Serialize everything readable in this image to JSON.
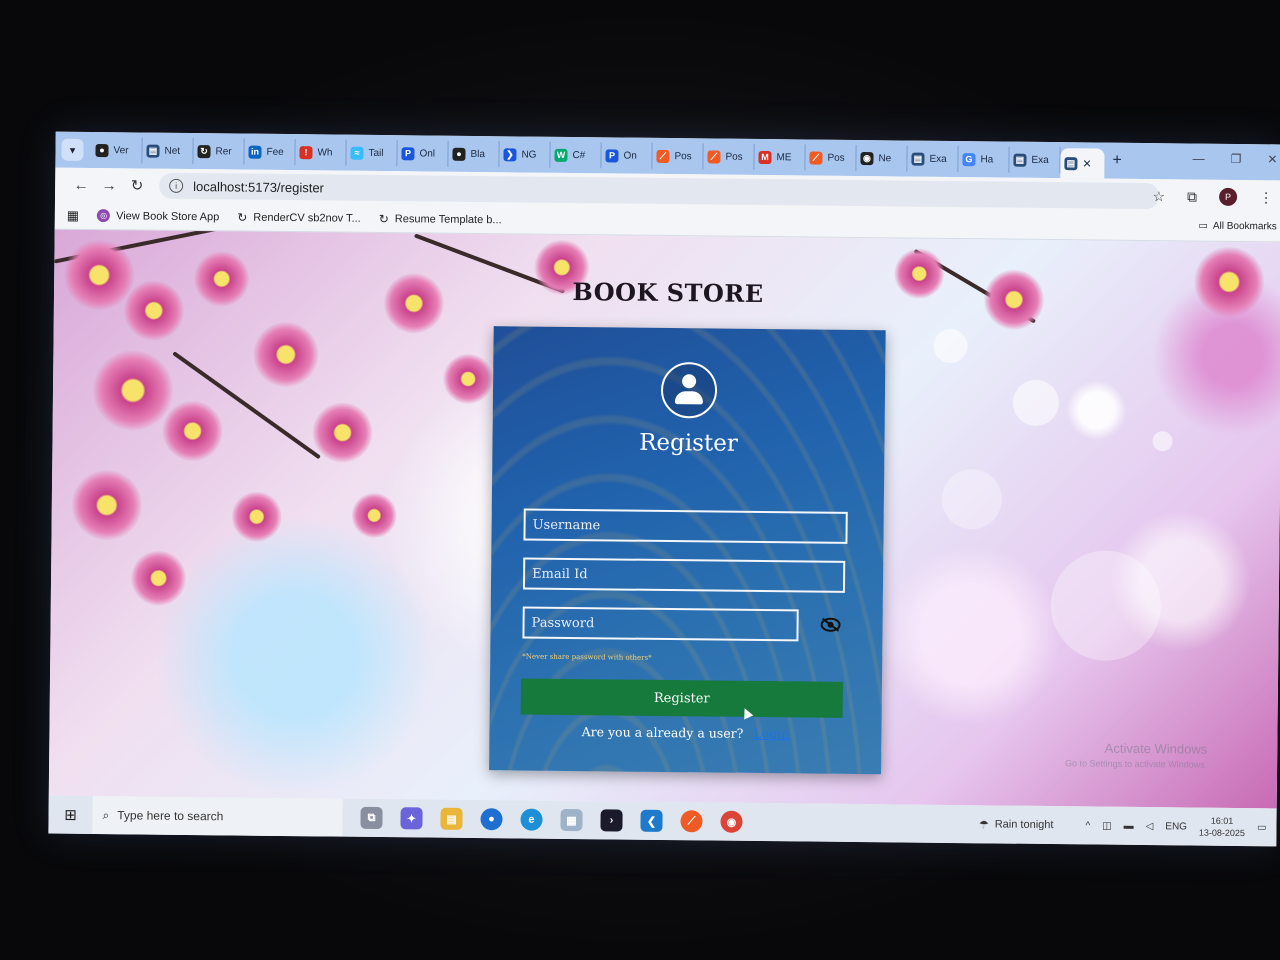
{
  "browser": {
    "tabs": [
      {
        "label": "Ver",
        "icon": "github-icon",
        "color": "#222222"
      },
      {
        "label": "Net",
        "icon": "store-icon",
        "color": "#2a4d7a"
      },
      {
        "label": "Rer",
        "icon": "render-icon",
        "color": "#222222"
      },
      {
        "label": "Fee",
        "icon": "linkedin-icon",
        "color": "#0a66c2"
      },
      {
        "label": "Wh",
        "icon": "alert-icon",
        "color": "#d93025"
      },
      {
        "label": "Tail",
        "icon": "tailwind-icon",
        "color": "#38bdf8"
      },
      {
        "label": "Onl",
        "icon": "p-icon",
        "color": "#1a56db"
      },
      {
        "label": "Bla",
        "icon": "github-icon",
        "color": "#222222"
      },
      {
        "label": "NG",
        "icon": "chevron-icon",
        "color": "#1a56db"
      },
      {
        "label": "C#",
        "icon": "w3-icon",
        "color": "#04aa6d"
      },
      {
        "label": "On",
        "icon": "p-icon",
        "color": "#1a56db"
      },
      {
        "label": "Pos",
        "icon": "postman-icon",
        "color": "#ef5b25"
      },
      {
        "label": "Pos",
        "icon": "postman-icon",
        "color": "#ef5b25"
      },
      {
        "label": "ME",
        "icon": "gmail-icon",
        "color": "#d93025"
      },
      {
        "label": "Pos",
        "icon": "postman-icon",
        "color": "#ef5b25"
      },
      {
        "label": "Ne",
        "icon": "chrome-icon",
        "color": "#222222"
      },
      {
        "label": "Exa",
        "icon": "store-icon",
        "color": "#2a4d7a"
      },
      {
        "label": "Ha",
        "icon": "google-icon",
        "color": "#4285f4"
      },
      {
        "label": "Exa",
        "icon": "store-icon",
        "color": "#2a4d7a"
      }
    ],
    "active_tab_icon": "store-icon",
    "url": "localhost:5173/register",
    "bookmarks": [
      {
        "label": "View Book Store App",
        "icon": "app-icon"
      },
      {
        "label": "RenderCV sb2nov T...",
        "icon": "render-icon"
      },
      {
        "label": "Resume Template b...",
        "icon": "render-icon"
      }
    ],
    "all_bookmarks": "All Bookmarks",
    "profile_initial": "P"
  },
  "page": {
    "store_title": "BOOK STORE",
    "form_title": "Register",
    "username_placeholder": "Username",
    "email_placeholder": "Email Id",
    "password_placeholder": "Password",
    "password_hint": "*Never share password with others*",
    "submit_label": "Register",
    "login_prompt": "Are you a already a user?",
    "login_link": "Login",
    "accent_color": "#157a3c"
  },
  "watermark": {
    "title": "Activate Windows",
    "subtitle": "Go to Settings to activate Windows."
  },
  "taskbar": {
    "search_placeholder": "Type here to search",
    "weather": "Rain tonight",
    "language": "ENG",
    "time": "16:01",
    "date": "13-08-2025"
  }
}
